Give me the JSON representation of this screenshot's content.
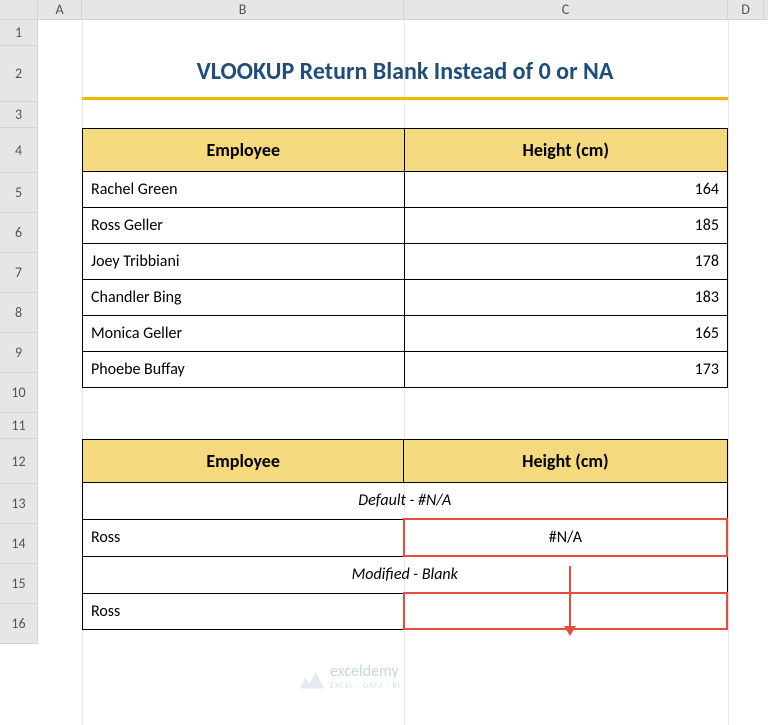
{
  "columns": {
    "A": "A",
    "B": "B",
    "C": "C",
    "D": "D"
  },
  "rows": [
    "1",
    "2",
    "3",
    "4",
    "5",
    "6",
    "7",
    "8",
    "9",
    "10",
    "11",
    "12",
    "13",
    "14",
    "15",
    "16"
  ],
  "title": "VLOOKUP Return Blank Instead of 0 or NA",
  "table1": {
    "headers": {
      "employee": "Employee",
      "height": "Height (cm)"
    },
    "rows": [
      {
        "name": "Rachel Green",
        "height": "164"
      },
      {
        "name": "Ross Geller",
        "height": "185"
      },
      {
        "name": "Joey Tribbiani",
        "height": "178"
      },
      {
        "name": "Chandler Bing",
        "height": "183"
      },
      {
        "name": "Monica Geller",
        "height": "165"
      },
      {
        "name": "Phoebe Buffay",
        "height": "173"
      }
    ]
  },
  "table2": {
    "headers": {
      "employee": "Employee",
      "height": "Height (cm)"
    },
    "section1_label": "Default - #N/A",
    "row1": {
      "name": "Ross",
      "value": "#N/A"
    },
    "section2_label": "Modified - Blank",
    "row2": {
      "name": "Ross",
      "value": ""
    }
  },
  "watermark": {
    "brand": "exceldemy",
    "tagline": "EXCEL · DATA · BI"
  }
}
